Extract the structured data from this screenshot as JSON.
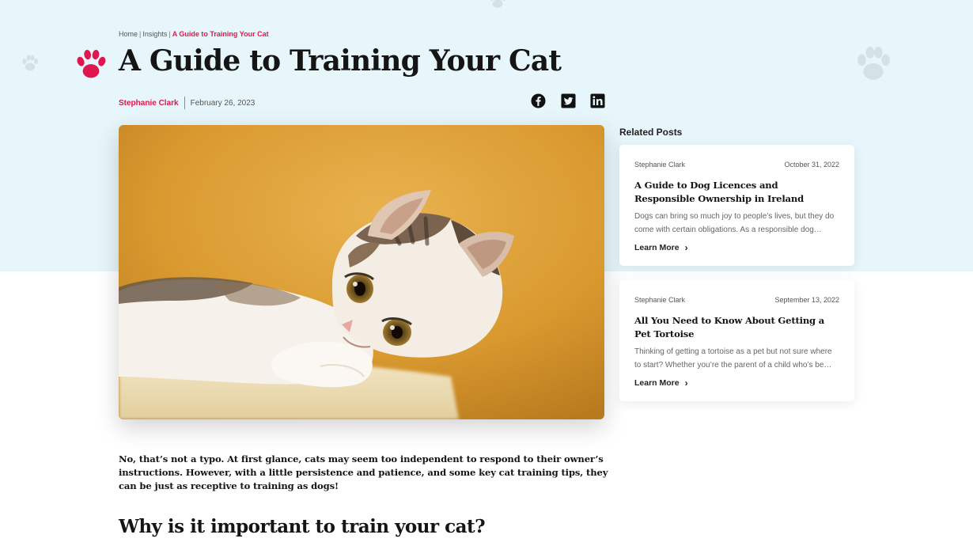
{
  "breadcrumb": {
    "home": "Home",
    "sep1": "|",
    "insights": "Insights",
    "sep2": "|",
    "current": "A Guide to Training Your Cat"
  },
  "title": "A Guide to Training Your Cat",
  "meta": {
    "author": "Stephanie Clark",
    "date": "February 26, 2023"
  },
  "share": [
    "facebook-icon",
    "twitter-icon",
    "linkedin-icon"
  ],
  "hero_image": {
    "subject": "kitten"
  },
  "article": {
    "intro": "No, that’s not a typo. At first glance, cats may seem too independent to respond to their owner’s instructions. However, with a little persistence and patience, and some key cat training tips, they can be just as receptive to training as dogs!",
    "h2": "Why is it important to train your cat?"
  },
  "related": {
    "heading": "Related Posts",
    "posts": [
      {
        "author": "Stephanie Clark",
        "date": "October 31, 2022",
        "title": "A Guide to Dog Licences and Responsible Ownership in Ireland",
        "excerpt": "Dogs can bring so much joy to people’s lives, but they do come with certain obligations. As a responsible dog…",
        "cta": "Learn More"
      },
      {
        "author": "Stephanie Clark",
        "date": "September 13, 2022",
        "title": "All You Need to Know About Getting a Pet Tortoise",
        "excerpt": "Thinking of getting a tortoise as a pet but not sure where to start? Whether you’re the parent of a child who’s be…",
        "cta": "Learn More"
      }
    ]
  },
  "colors": {
    "accent": "#e0174f",
    "hero_bg": "#e6f6fa",
    "text": "#151515"
  }
}
